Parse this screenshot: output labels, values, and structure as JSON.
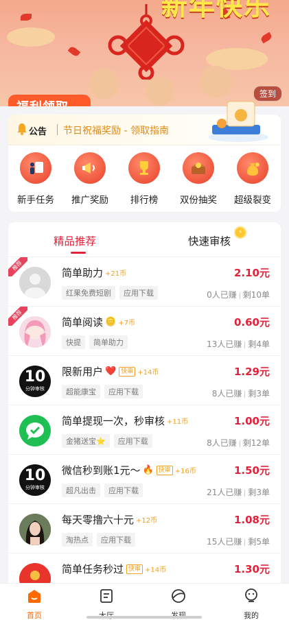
{
  "banner": {
    "title": "新年快乐",
    "welfare_label": "福利领取",
    "signin_label": "签到"
  },
  "notice": {
    "label": "公告",
    "text": "节日祝福奖励 - 领取指南"
  },
  "quick_actions": [
    {
      "label": "新手任务",
      "icon": "newbie-task-icon"
    },
    {
      "label": "推广奖励",
      "icon": "megaphone-icon"
    },
    {
      "label": "排行榜",
      "icon": "trophy-icon"
    },
    {
      "label": "双份抽奖",
      "icon": "treasure-chest-icon"
    },
    {
      "label": "超级裂变",
      "icon": "money-bag-icon"
    }
  ],
  "tabs": {
    "recommended": "精品推荐",
    "fast_review": "快速审核"
  },
  "tasks": [
    {
      "title": "简单助力",
      "coins": "+21币",
      "fast": "",
      "emoji": "",
      "tags": [
        "红果免费短剧",
        "应用下载"
      ],
      "price": "2.10元",
      "earned": "0人已赚",
      "left": "剩10单",
      "ribbon": "推荐",
      "avatar": "grey"
    },
    {
      "title": "简单阅读",
      "coins": "+7币",
      "fast": "",
      "emoji": "🪙",
      "tags": [
        "快提",
        "简单助力"
      ],
      "price": "0.60元",
      "earned": "13人已赚",
      "left": "剩4单",
      "ribbon": "推荐",
      "avatar": "anime"
    },
    {
      "title": "限新用户",
      "coins": "+14币",
      "fast": "快审",
      "emoji": "❤️",
      "tags": [
        "超能康宝",
        "应用下载"
      ],
      "price": "1.29元",
      "earned": "8人已赚",
      "left": "剩3单",
      "ribbon": "",
      "avatar": "ten",
      "avatar_big": "10",
      "avatar_small": "分钟审核"
    },
    {
      "title": "简单提现一次，秒审核",
      "coins": "+11币",
      "fast": "",
      "emoji": "",
      "tags": [
        "金猪送宝⭐",
        "应用下载"
      ],
      "price": "1.00元",
      "earned": "8人已赚",
      "left": "剩12单",
      "ribbon": "",
      "avatar": "wechat"
    },
    {
      "title": "微信秒到账1元～",
      "coins": "+16币",
      "fast": "快审",
      "emoji": "🔥",
      "tags": [
        "超凡出击",
        "应用下载"
      ],
      "price": "1.50元",
      "earned": "21人已赚",
      "left": "剩3单",
      "ribbon": "",
      "avatar": "ten",
      "avatar_big": "10",
      "avatar_small": "分钟审核"
    },
    {
      "title": "每天零撸六十元",
      "coins": "+12币",
      "fast": "",
      "emoji": "",
      "tags": [
        "淘热点",
        "应用下载"
      ],
      "price": "1.08元",
      "earned": "15人已赚",
      "left": "剩5单",
      "ribbon": "",
      "avatar": "photo"
    },
    {
      "title": "简单任务秒过",
      "coins": "+14币",
      "fast": "快审",
      "emoji": "",
      "tags": [
        "",
        ""
      ],
      "price": "1.30元",
      "earned": "",
      "left": "",
      "ribbon": "",
      "avatar": "red"
    }
  ],
  "bottom_nav": [
    {
      "label": "首页",
      "icon": "home-icon",
      "active": true
    },
    {
      "label": "大厅",
      "icon": "hall-icon",
      "active": false
    },
    {
      "label": "发现",
      "icon": "discover-icon",
      "active": false
    },
    {
      "label": "我的",
      "icon": "profile-icon",
      "active": false
    }
  ],
  "colors": {
    "accent": "#e3223a",
    "nav_active": "#ff6a00",
    "notice_text": "#e08a18"
  }
}
